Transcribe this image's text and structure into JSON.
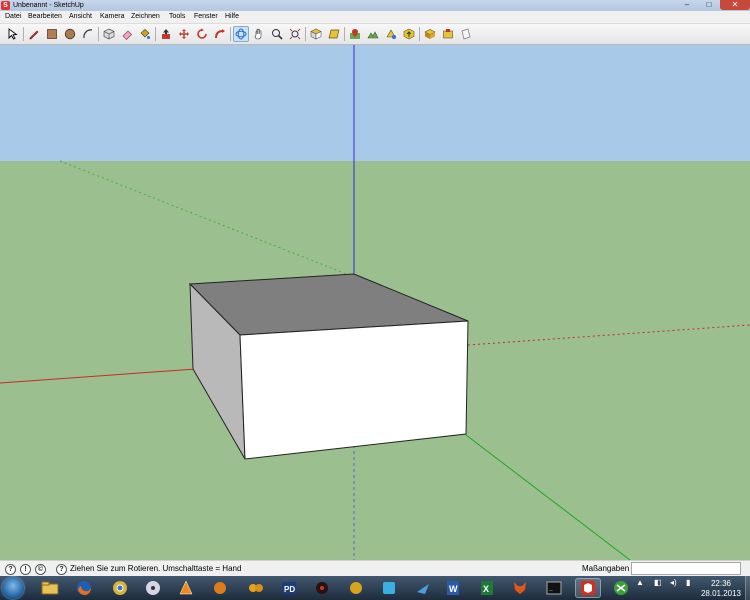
{
  "window": {
    "title": "Unbenannt - SketchUp",
    "controls": {
      "minimize": "–",
      "maximize": "□",
      "close": "✕"
    }
  },
  "menu": [
    "Datei",
    "Bearbeiten",
    "Ansicht",
    "Kamera",
    "Zeichnen",
    "Tools",
    "Fenster",
    "Hilfe"
  ],
  "toolbar": {
    "tools": [
      "select-icon",
      "line-pencil-icon",
      "rectangle-icon",
      "circle-icon",
      "arc-icon",
      "make-component-icon",
      "eraser-icon",
      "paint-bucket-icon",
      "push-pull-icon",
      "move-icon",
      "rotate-icon",
      "follow-me-icon",
      "orbit-icon",
      "pan-icon",
      "zoom-icon",
      "zoom-extents-icon",
      "iso-view-icon",
      "top-view-icon",
      "add-location-icon",
      "toggle-terrain-icon",
      "get-models-icon",
      "share-model-icon",
      "share-component-icon",
      "extension-warehouse-icon",
      "layout-icon"
    ],
    "selected": "orbit-icon"
  },
  "scene": {
    "sky_color": "#a9c9e9",
    "ground_color": "#9cbf8f",
    "axis_blue": "#2b2bd9",
    "axis_red": "#c62a2a",
    "axis_green": "#1da81d"
  },
  "status": {
    "icons": [
      "geo-location-icon",
      "credits-icon",
      "help-icon"
    ],
    "text": "Ziehen Sie zum Rotieren.  Umschalttaste = Hand",
    "measurements_label": "Maßangaben",
    "measurements_value": ""
  },
  "taskbar": {
    "apps": [
      "explorer-icon",
      "firefox-icon",
      "chrome-icon",
      "media-player-icon",
      "vlc-icon",
      "gamepad-icon",
      "pd-app-icon",
      "media-app-icon",
      "audacity-icon",
      "calculator-icon",
      "plane-app-icon",
      "word-icon",
      "excel-icon",
      "fox-app-icon",
      "terminal-icon",
      "sketchup-icon",
      "xampp-icon"
    ],
    "active": "sketchup-icon",
    "tray_arrow": "▲",
    "time": "22:36",
    "date": "28.01.2013"
  }
}
